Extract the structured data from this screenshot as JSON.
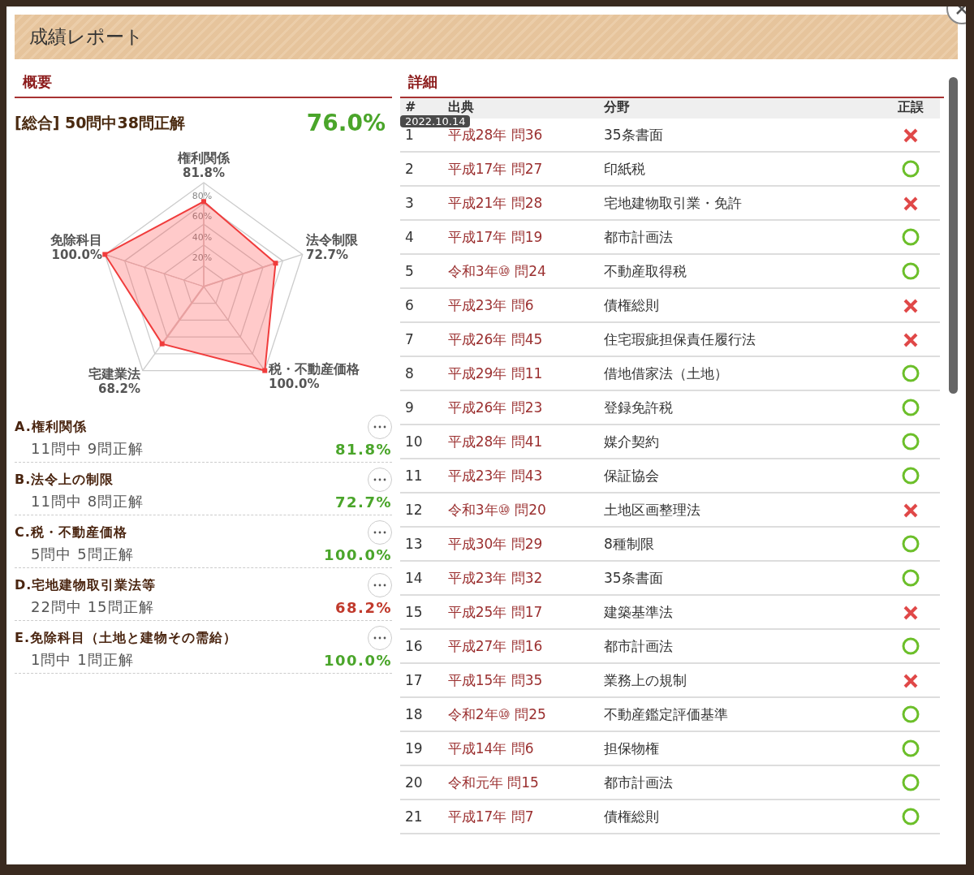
{
  "window": {
    "title": "成績レポート"
  },
  "summary": {
    "heading": "概要",
    "total_label": "[総合] 50問中38問正解",
    "total_rate": "76.0%",
    "radar": {
      "ticks": [
        "80%",
        "60%",
        "40%",
        "20%"
      ],
      "axes": [
        {
          "label": "権利関係",
          "reading": "81.8%",
          "level": 0.818
        },
        {
          "label": "免除科目",
          "reading": "100.0%",
          "level": 1.0
        },
        {
          "label": "法令制限",
          "reading": "72.7%",
          "level": 0.727
        },
        {
          "label": "宅建業法",
          "reading": "68.2%",
          "level": 0.682
        },
        {
          "label": "税・不動産価格",
          "reading": "100.0%",
          "level": 1.0
        }
      ]
    },
    "categories": [
      {
        "title": "A.権利関係",
        "count": "11問中 9問正解",
        "rate": "81.8%",
        "color": "#4aa52a"
      },
      {
        "title": "B.法令上の制限",
        "count": "11問中 8問正解",
        "rate": "72.7%",
        "color": "#4aa52a"
      },
      {
        "title": "C.税・不動産価格",
        "count": "5問中 5問正解",
        "rate": "100.0%",
        "color": "#4aa52a"
      },
      {
        "title": "D.宅地建物取引業法等",
        "count": "22問中 15問正解",
        "rate": "68.2%",
        "color": "#c0392b"
      },
      {
        "title": "E.免除科目（土地と建物その需給）",
        "count": "1問中 1問正解",
        "rate": "100.0%",
        "color": "#4aa52a"
      }
    ]
  },
  "details": {
    "heading": "詳細",
    "tooltip": "2022.10.14",
    "columns": [
      "#",
      "出典",
      "分野",
      "正誤"
    ],
    "rows": [
      {
        "number": "1",
        "source": "平成28年 問36",
        "field": "35条書面",
        "correct": false
      },
      {
        "number": "2",
        "source": "平成17年 問27",
        "field": "印紙税",
        "correct": true
      },
      {
        "number": "3",
        "source": "平成21年 問28",
        "field": "宅地建物取引業・免許",
        "correct": false
      },
      {
        "number": "4",
        "source": "平成17年 問19",
        "field": "都市計画法",
        "correct": true
      },
      {
        "number": "5",
        "source": "令和3年⑩ 問24",
        "field": "不動産取得税",
        "correct": true
      },
      {
        "number": "6",
        "source": "平成23年 問6",
        "field": "債権総則",
        "correct": false
      },
      {
        "number": "7",
        "source": "平成26年 問45",
        "field": "住宅瑕疵担保責任履行法",
        "correct": false
      },
      {
        "number": "8",
        "source": "平成29年 問11",
        "field": "借地借家法（土地）",
        "correct": true
      },
      {
        "number": "9",
        "source": "平成26年 問23",
        "field": "登録免許税",
        "correct": true
      },
      {
        "number": "10",
        "source": "平成28年 問41",
        "field": "媒介契約",
        "correct": true
      },
      {
        "number": "11",
        "source": "平成23年 問43",
        "field": "保証協会",
        "correct": true
      },
      {
        "number": "12",
        "source": "令和3年⑩ 問20",
        "field": "土地区画整理法",
        "correct": false
      },
      {
        "number": "13",
        "source": "平成30年 問29",
        "field": "8種制限",
        "correct": true
      },
      {
        "number": "14",
        "source": "平成23年 問32",
        "field": "35条書面",
        "correct": true
      },
      {
        "number": "15",
        "source": "平成25年 問17",
        "field": "建築基準法",
        "correct": false
      },
      {
        "number": "16",
        "source": "平成27年 問16",
        "field": "都市計画法",
        "correct": true
      },
      {
        "number": "17",
        "source": "平成15年 問35",
        "field": "業務上の規制",
        "correct": false
      },
      {
        "number": "18",
        "source": "令和2年⑩ 問25",
        "field": "不動産鑑定評価基準",
        "correct": true
      },
      {
        "number": "19",
        "source": "平成14年 問6",
        "field": "担保物権",
        "correct": true
      },
      {
        "number": "20",
        "source": "令和元年 問15",
        "field": "都市計画法",
        "correct": true
      },
      {
        "number": "21",
        "source": "平成17年 問7",
        "field": "債権総則",
        "correct": true
      }
    ]
  }
}
